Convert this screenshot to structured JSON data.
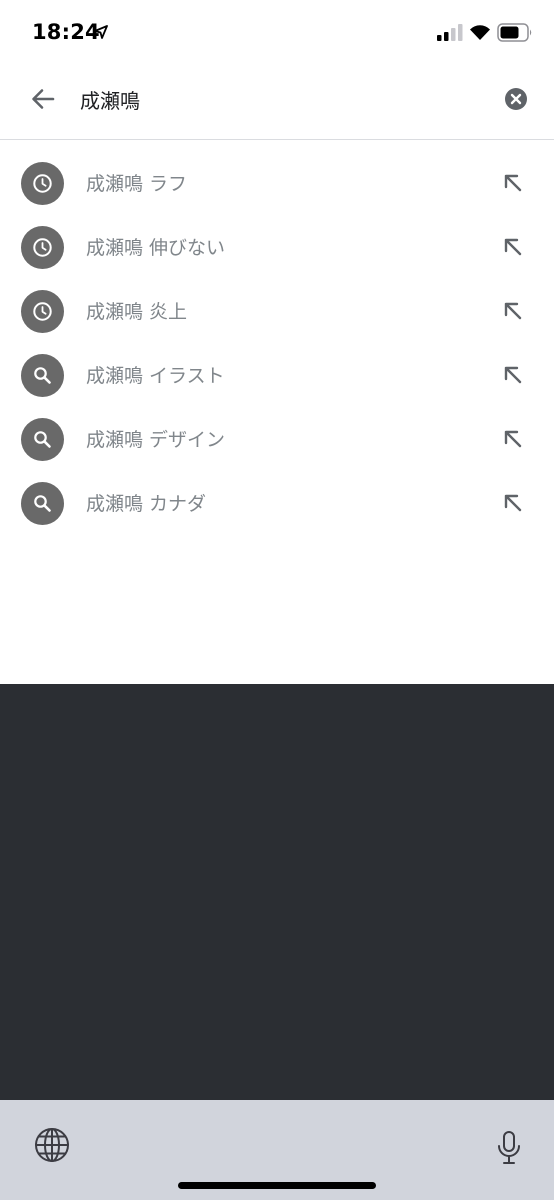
{
  "status_bar": {
    "time": "18:24"
  },
  "search": {
    "query": "成瀬鳴"
  },
  "suggestions": [
    {
      "kind": "history",
      "icon": "clock-icon",
      "text": "成瀬鳴 ラフ"
    },
    {
      "kind": "history",
      "icon": "clock-icon",
      "text": "成瀬鳴 伸びない"
    },
    {
      "kind": "history",
      "icon": "clock-icon",
      "text": "成瀬鳴 炎上"
    },
    {
      "kind": "search",
      "icon": "search-icon",
      "text": "成瀬鳴 イラスト"
    },
    {
      "kind": "search",
      "icon": "search-icon",
      "text": "成瀬鳴 デザイン"
    },
    {
      "kind": "search",
      "icon": "search-icon",
      "text": "成瀬鳴 カナダ"
    }
  ],
  "colors": {
    "badge": "#696969",
    "suggestion_text": "#80868b",
    "keyboard": "#2b2e33",
    "keyboard_bar": "#d1d4dc"
  }
}
